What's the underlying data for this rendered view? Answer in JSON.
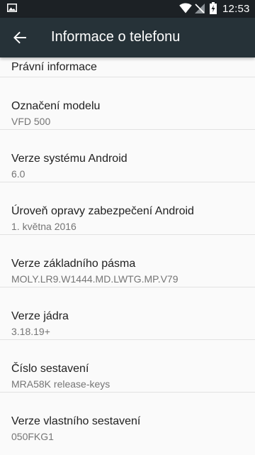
{
  "status_bar": {
    "time": "12:53",
    "icons": [
      "image-notification-icon",
      "wifi-icon",
      "no-sim-signal-icon",
      "battery-charging-icon"
    ]
  },
  "app_bar": {
    "title": "Informace o telefonu",
    "back_icon": "arrow-back-icon"
  },
  "colors": {
    "status_bar": "#1c2125",
    "app_bar": "#263238",
    "background": "#fafafa",
    "title_text": "#212121",
    "summary_text": "#757575",
    "divider": "#e2e2e2"
  },
  "items": [
    {
      "title": "Právní informace"
    },
    {
      "title": "Označení modelu",
      "summary": "VFD 500"
    },
    {
      "title": "Verze systému Android",
      "summary": "6.0"
    },
    {
      "title": "Úroveň opravy zabezpečení Android",
      "summary": "1. května 2016"
    },
    {
      "title": "Verze základního pásma",
      "summary": "MOLY.LR9.W1444.MD.LWTG.MP.V79"
    },
    {
      "title": "Verze jádra",
      "summary": "3.18.19+"
    },
    {
      "title": "Číslo sestavení",
      "summary": "MRA58K release-keys"
    },
    {
      "title": "Verze vlastního sestavení",
      "summary": "050FKG1"
    }
  ]
}
